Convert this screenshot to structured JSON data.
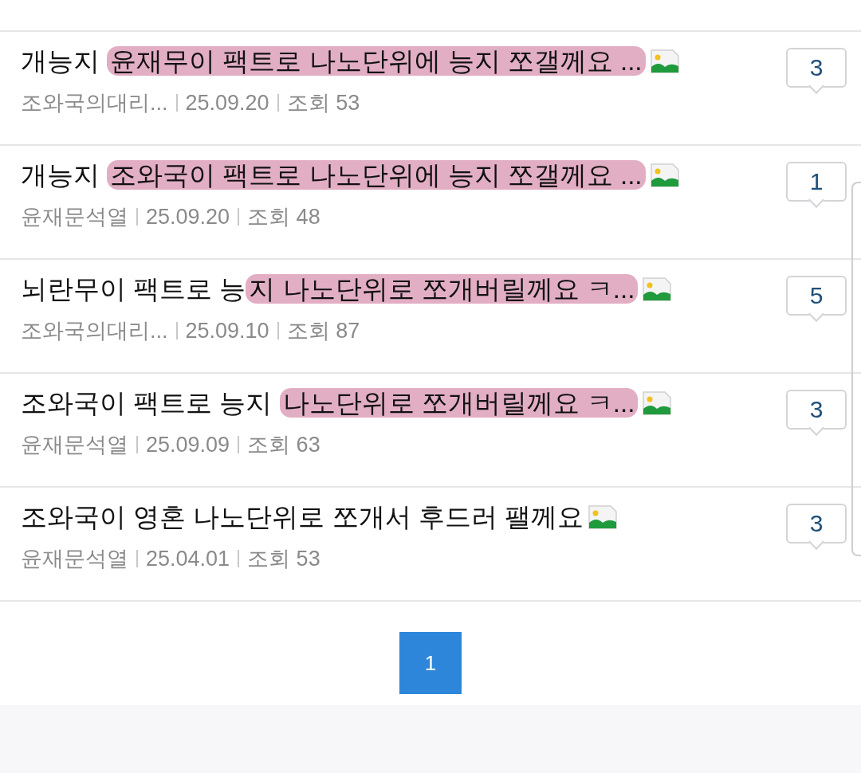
{
  "posts": [
    {
      "title_parts": [
        {
          "text": "개능지 ",
          "highlighted": false
        },
        {
          "text": "윤재무이 팩트로 나노단위에 능지 쪼갤께요 ...",
          "highlighted": true
        }
      ],
      "has_image": true,
      "author": "조와국의대리...",
      "date": "25.09.20",
      "views": "조회 53",
      "comments": "3"
    },
    {
      "title_parts": [
        {
          "text": "개능지 ",
          "highlighted": false
        },
        {
          "text": "조와국이 팩트로 나노단위에 능지 쪼갤께요 ...",
          "highlighted": true
        }
      ],
      "has_image": true,
      "author": "윤재문석열",
      "date": "25.09.20",
      "views": "조회 48",
      "comments": "1"
    },
    {
      "title_parts": [
        {
          "text": "뇌란무이 팩트로 능",
          "highlighted": false
        },
        {
          "text": "지 나노단위로 쪼개버릴께요 ㅋ...",
          "highlighted": true
        }
      ],
      "has_image": true,
      "author": "조와국의대리...",
      "date": "25.09.10",
      "views": "조회 87",
      "comments": "5"
    },
    {
      "title_parts": [
        {
          "text": "조와국이 팩트로 능지 ",
          "highlighted": false
        },
        {
          "text": "나노단위로 쪼개버릴께요 ㅋ...",
          "highlighted": true
        }
      ],
      "has_image": true,
      "author": "윤재문석열",
      "date": "25.09.09",
      "views": "조회 63",
      "comments": "3"
    },
    {
      "title_parts": [
        {
          "text": "조와국이 영혼 나노단위로 쪼개서 후드러 팰께요",
          "highlighted": false
        }
      ],
      "has_image": true,
      "author": "윤재문석열",
      "date": "25.04.01",
      "views": "조회 53",
      "comments": "3"
    }
  ],
  "pagination": [
    {
      "label": "1",
      "selected": true
    }
  ]
}
